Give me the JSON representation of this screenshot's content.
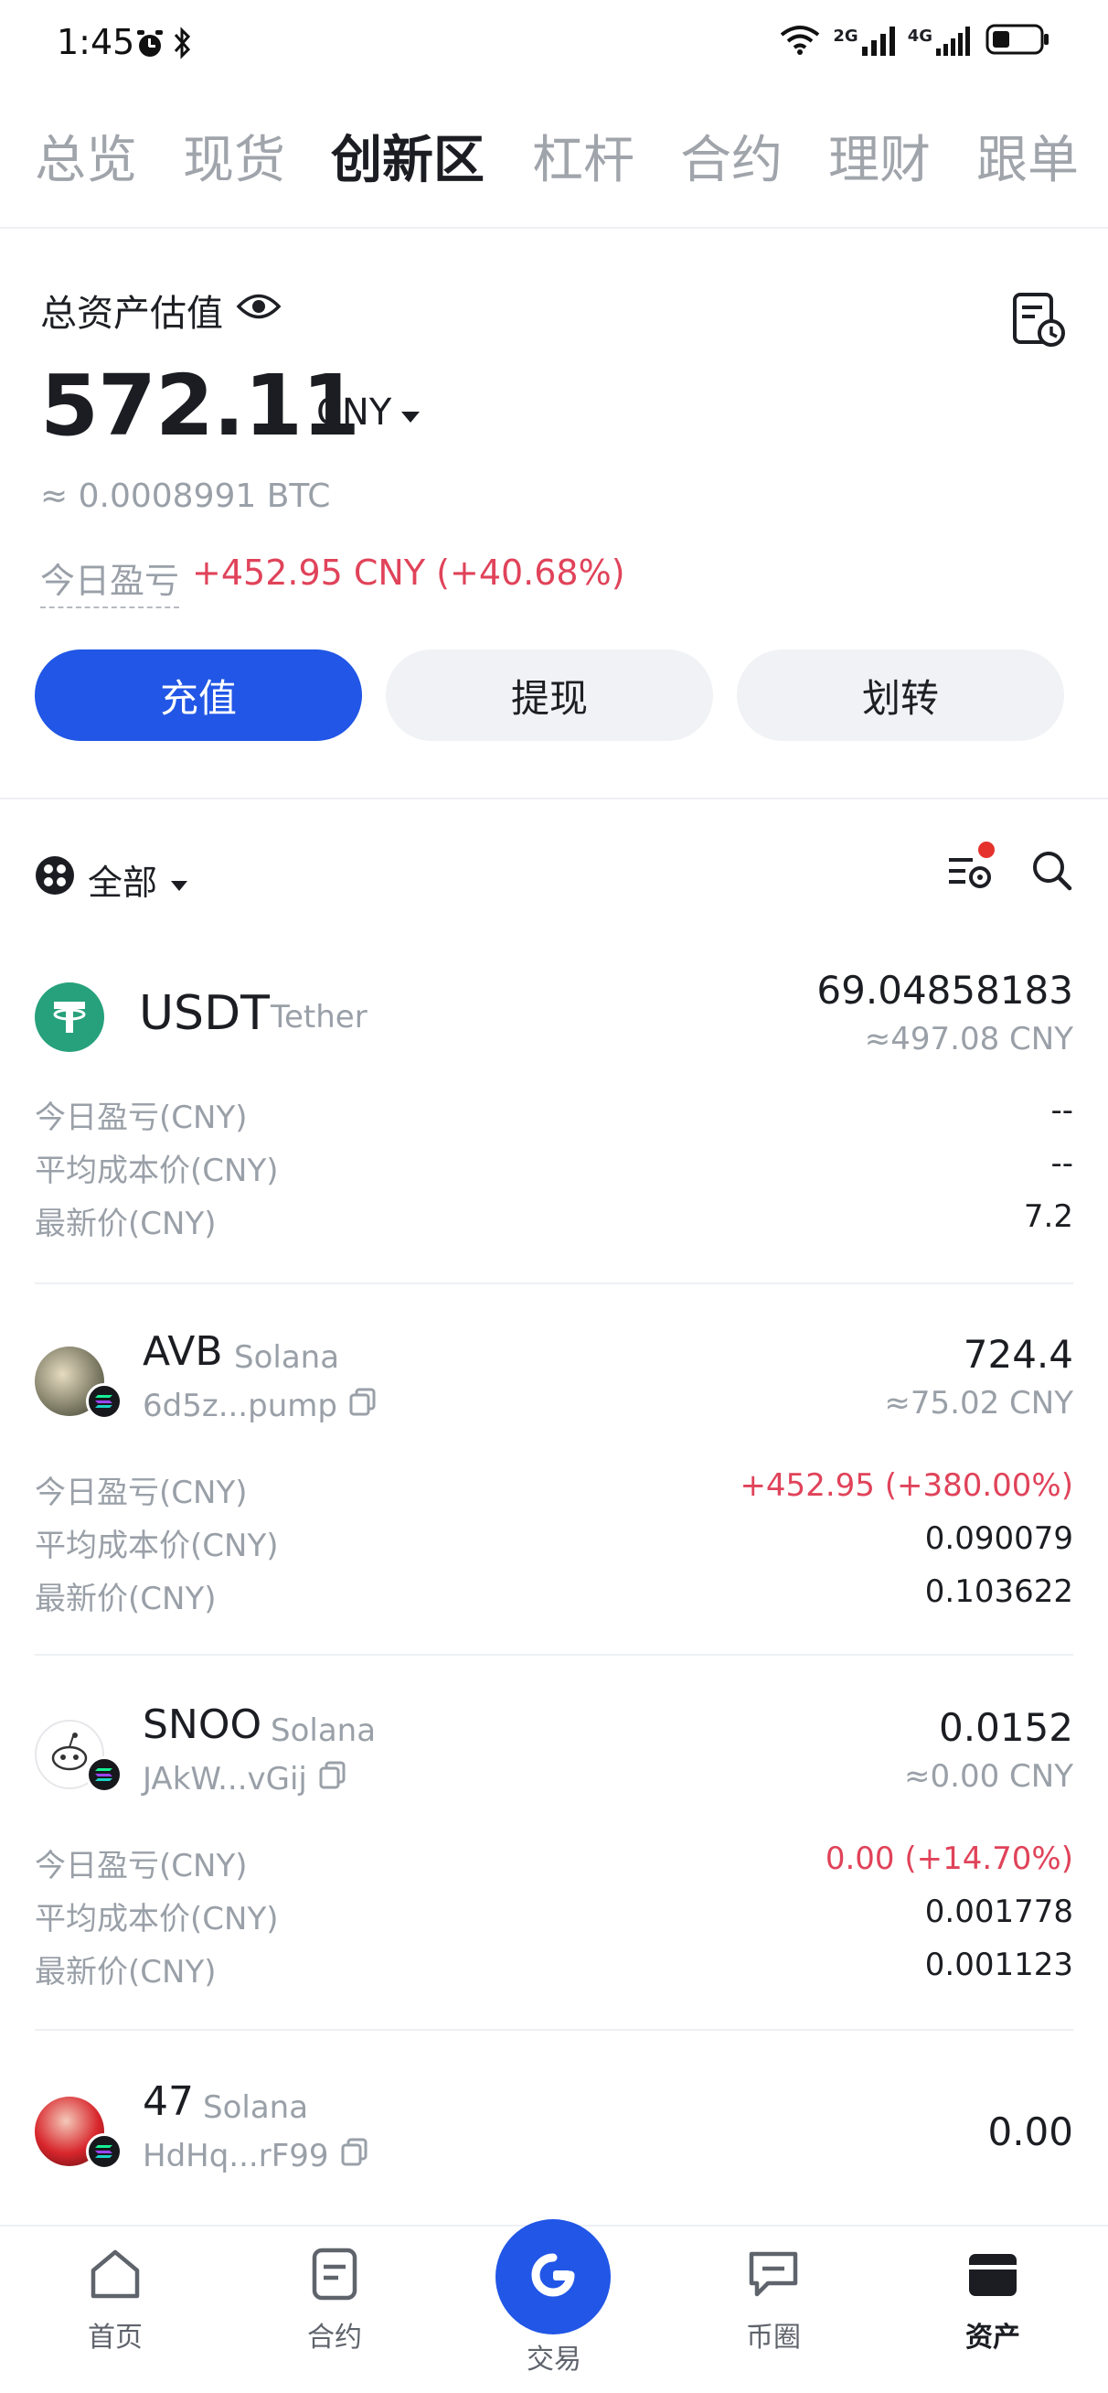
{
  "status_bar": {
    "time": "1:45",
    "net1": "2G",
    "net2": "4G"
  },
  "tabs": [
    {
      "label": "总览"
    },
    {
      "label": "现货"
    },
    {
      "label": "创新区"
    },
    {
      "label": "杠杆"
    },
    {
      "label": "合约"
    },
    {
      "label": "理财"
    },
    {
      "label": "跟单"
    }
  ],
  "assets": {
    "title": "总资产估值",
    "value": "572.11",
    "currency": "CNY",
    "btc_equiv": "≈ 0.0008991 BTC",
    "pnl_label": "今日盈亏",
    "pnl_value": "+452.95 CNY (+40.68%)"
  },
  "actions": {
    "deposit": "充值",
    "withdraw": "提现",
    "transfer": "划转"
  },
  "filter": {
    "label": "全部"
  },
  "stat_labels": {
    "pnl": "今日盈亏(CNY)",
    "avg_cost": "平均成本价(CNY)",
    "latest": "最新价(CNY)"
  },
  "coins": [
    {
      "symbol": "USDT",
      "chain": "Tether",
      "address": "",
      "amount": "69.04858183",
      "fiat": "≈497.08 CNY",
      "pnl": "--",
      "avg_cost": "--",
      "latest": "7.2"
    },
    {
      "symbol": "AVB",
      "chain": "Solana",
      "address": "6d5z...pump",
      "amount": "724.4",
      "fiat": "≈75.02 CNY",
      "pnl": "+452.95 (+380.00%)",
      "avg_cost": "0.090079",
      "latest": "0.103622"
    },
    {
      "symbol": "SNOO",
      "chain": "Solana",
      "address": "JAkW...vGij",
      "amount": "0.0152",
      "fiat": "≈0.00 CNY",
      "pnl": "0.00 (+14.70%)",
      "avg_cost": "0.001778",
      "latest": "0.001123"
    },
    {
      "symbol": "47",
      "chain": "Solana",
      "address": "HdHq...rF99",
      "amount": "0.00",
      "fiat": ""
    }
  ],
  "bottom_nav": [
    {
      "label": "首页",
      "icon": "home-icon"
    },
    {
      "label": "合约",
      "icon": "contract-icon"
    },
    {
      "label": "交易",
      "icon": "trade-icon"
    },
    {
      "label": "币圈",
      "icon": "chat-icon"
    },
    {
      "label": "资产",
      "icon": "wallet-icon"
    }
  ],
  "colors": {
    "accent": "#2156e6",
    "up": "#e0435a",
    "muted": "#9aa0a8"
  }
}
